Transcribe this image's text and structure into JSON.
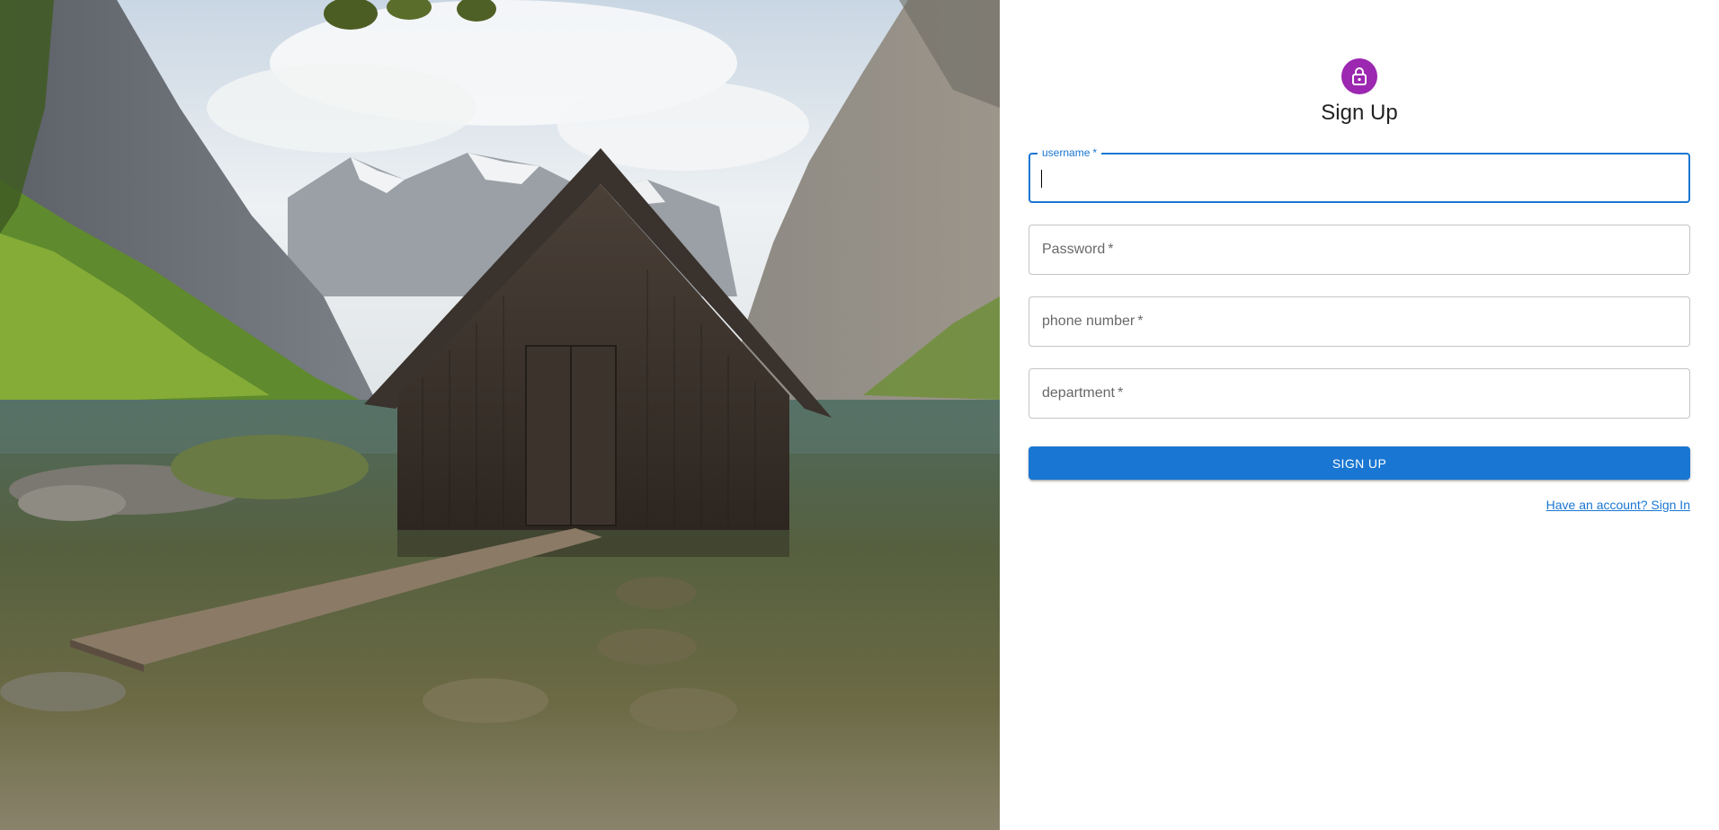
{
  "hero_image": {
    "description_icon": "boathouse-landscape-image"
  },
  "form": {
    "avatar_icon": "lock-icon",
    "avatar_color": "#9c27b0",
    "title": "Sign Up",
    "fields": [
      {
        "label": "username",
        "required_mark": "*",
        "value": "",
        "focused": true
      },
      {
        "label": "Password",
        "required_mark": "*",
        "value": "",
        "focused": false
      },
      {
        "label": "phone number",
        "required_mark": "*",
        "value": "",
        "focused": false
      },
      {
        "label": "department",
        "required_mark": "*",
        "value": "",
        "focused": false
      }
    ],
    "submit_label": "SIGN UP",
    "signin_link": "Have an account? Sign In",
    "accent_color": "#1976d2"
  }
}
